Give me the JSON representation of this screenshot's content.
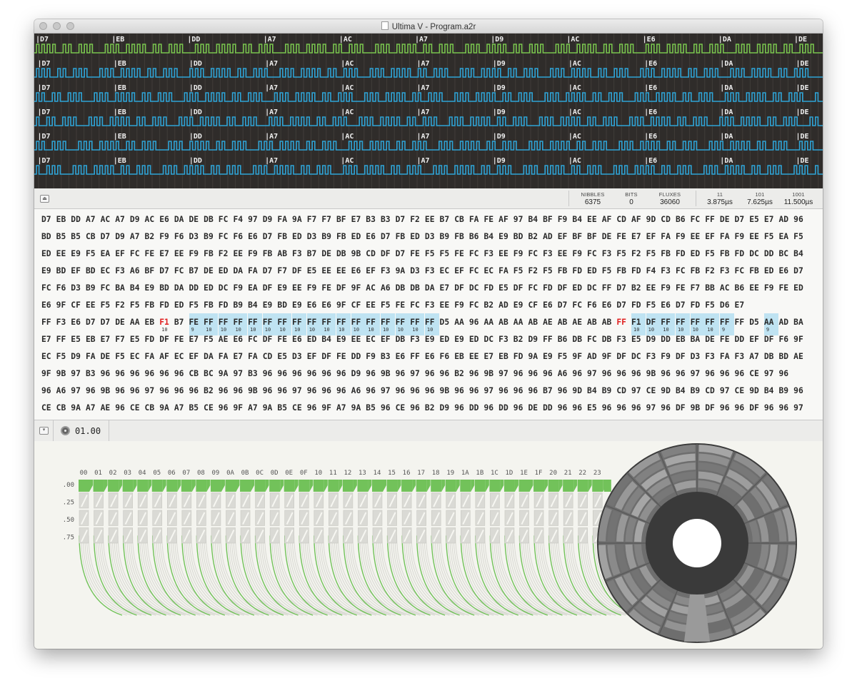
{
  "window": {
    "title": "Ultima V - Program.a2r"
  },
  "flux": {
    "labels": [
      "|D7",
      "|EB",
      "|DD",
      "|A7",
      "|AC",
      "|A7",
      "|D9",
      "|AC",
      "|E6",
      "|DA",
      "|DE"
    ],
    "rows": [
      {
        "color": "#79c44e"
      },
      {
        "color": "#2ea3d6"
      },
      {
        "color": "#2ea3d6"
      },
      {
        "color": "#2ea3d6"
      },
      {
        "color": "#2ea3d6"
      },
      {
        "color": "#2ea3d6"
      }
    ]
  },
  "status": {
    "stats": [
      {
        "key": "NIBBLES",
        "value": "6375"
      },
      {
        "key": "BITS",
        "value": "0"
      },
      {
        "key": "FLUXES",
        "value": "36060"
      },
      {
        "key": "11",
        "value": "3.875µs"
      },
      {
        "key": "101",
        "value": "7.625µs"
      },
      {
        "key": "1001",
        "value": "11.500µs"
      }
    ]
  },
  "hex": {
    "rows": [
      "D7 EB DD A7 AC A7 D9 AC E6 DA DE DB FC F4 97 D9 FA 9A F7 F7 BF E7 B3 B3 D7 F2 EE B7 CB FA FE AF 97 B4 BF F9 B4 EE AF CD AF 9D CD B6 FC FF DE D7 E5 E7 AD 96",
      "BD B5 B5 CB D7 D9 A7 B2 F9 F6 D3 B9 FC F6 E6 D7 FB ED D3 B9 FB ED E6 D7 FB ED D3 B9 FB B6 B4 E9 BD B2 AD EF BF BF DE FE E7 EF FA F9 EE EF FA F9 EE F5 EA F5",
      "ED EE E9 F5 EA EF FC FE E7 EE F9 FB F2 EE F9 FB AB F3 B7 DE DB 9B CD DF D7 FE F5 F5 FE FC F3 EE F9 FC F3 EE F9 FC F3 F5 F2 F5 FB FD ED F5 FB FD DC DD BC B4",
      "E9 BD EF BD EC F3 A6 BF D7 FC B7 DE ED DA FA D7 F7 DF E5 EE EE E6 EF F3 9A D3 F3 EC EF FC EC FA F5 F2 F5 FB FD ED F5 FB FD F4 F3 FC FB F2 F3 FC FB ED E6 D7",
      "FC F6 D3 B9 FC BA B4 E9 BD DA DD ED DC F9 EA DF E9 EE F9 FE DF 9F AC A6 DB DB DA E7 DF DC FD E5 DF FC FD DF ED DC FF D7 B2 EE F9 FE F7 BB AC B6 EE F9 FE ED",
      "E6 9F CF EE F5 F2 F5 FB FD ED F5 FB FD B9 B4 E9 BD E9 E6 E6 9F CF EE F5 FE FC F3 EE F9 FC B2 AD E9 CF E6 D7 FC F6 E6 D7 FD F5 E6 D7 FD F5 D6 E7",
      "FF F3 E6 D7 D7 DE AA EB F1 B7 FE FF FF FF FF FF FF FF FF FF FF FF FF FF FF FF FF D5 AA 96 AA AB AA AB AE AB AE AB AB FF F1 DF FF FF FF FF FF FF D5 AA AD BA",
      "E7 FF E5 EB E7 F7 E5 FD DF FE E7 F5 AE E6 FC DF FE E6 ED B4 E9 EE EC EF DB F3 E9 ED E9 ED DC F3 B2 D9 FF B6 DB FC DB F3 E5 D9 DD EB BA DE FE DD EF DF F6 9F",
      "EC F5 D9 FA DE F5 EC FA AF EC EF DA FA E7 FA CD E5 D3 EF DF FE DD F9 B3 E6 FF E6 F6 EB EE E7 EB FD 9A E9 F5 9F AD 9F DF DC F3 F9 DF D3 F3 FA F3 A7 DB BD AE",
      "9F 9B 97 B3 96 96 96 96 96 96 CB BC 9A 97 B3 96 96 96 96 96 96 D9 96 9B 96 97 96 96 B2 96 9B 97 96 96 96 A6 96 97 96 96 96 9B 96 96 97 96 96 96 CE 97 96",
      "96 A6 97 96 9B 96 96 97 96 96 96 B2 96 96 9B 96 96 97 96 96 96 A6 96 97 96 96 96 9B 96 96 97 96 96 96 B7 96 9D B4 B9 CD 97 CE 9D B4 B9 CD 97 CE 9D B4 B9 96",
      "CE CB 9A A7 AE 96 CE CB 9A A7 B5 CE 96 9F A7 9A B5 CE 96 9F A7 9A B5 96 CE 96 B2 D9 96 DD 96 DD 96 DE DD 96 96 E5 96 96 96 97 96 DF 9B DF 96 96 DF 96 96 97"
    ],
    "marked_row": 6,
    "red_bytes": [
      8,
      39
    ],
    "selected_ranges": [
      [
        10,
        26
      ],
      [
        40,
        46
      ],
      [
        49,
        49
      ]
    ],
    "sub_labels": {
      "8": "10",
      "10": "9",
      "11": "10",
      "12": "10",
      "13": "10",
      "14": "10",
      "15": "10",
      "16": "10",
      "17": "10",
      "18": "10",
      "19": "10",
      "20": "10",
      "21": "10",
      "22": "10",
      "23": "10",
      "24": "10",
      "25": "10",
      "26": "10",
      "40": "10",
      "41": "10",
      "42": "10",
      "43": "10",
      "44": "10",
      "45": "10",
      "46": "9",
      "49": "9"
    }
  },
  "track": {
    "current": "01.00"
  },
  "tracks": {
    "labels": [
      "00",
      "01",
      "02",
      "03",
      "04",
      "05",
      "06",
      "07",
      "08",
      "09",
      "0A",
      "0B",
      "0C",
      "0D",
      "0E",
      "0F",
      "10",
      "11",
      "12",
      "13",
      "14",
      "15",
      "16",
      "17",
      "18",
      "19",
      "1A",
      "1B",
      "1C",
      "1D",
      "1E",
      "1F",
      "20",
      "21",
      "22",
      "23"
    ],
    "quarters": [
      ".00",
      ".25",
      ".50",
      ".75"
    ],
    "green": "#72c25a"
  }
}
